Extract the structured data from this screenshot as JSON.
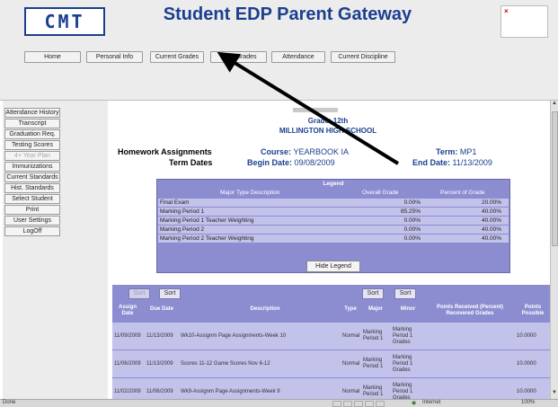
{
  "app": {
    "logo": "CMT",
    "title": "Student EDP Parent Gateway",
    "broken_image": "×"
  },
  "nav": {
    "tabs": [
      {
        "label": "Home"
      },
      {
        "label": "Personal Info"
      },
      {
        "label": "Current Grades"
      },
      {
        "label": "Final Grades"
      },
      {
        "label": "Attendance"
      },
      {
        "label": "Current Discipline"
      }
    ]
  },
  "sidebar": {
    "items": [
      {
        "label": "Attendance History",
        "enabled": true
      },
      {
        "label": "Transcript",
        "enabled": true
      },
      {
        "label": "Graduation Req.",
        "enabled": true
      },
      {
        "label": "Testing Scores",
        "enabled": true
      },
      {
        "label": "4+ Year Plan",
        "enabled": false
      },
      {
        "label": "Immunizations",
        "enabled": true
      },
      {
        "label": "Current Standards",
        "enabled": true
      },
      {
        "label": "Hist. Standards",
        "enabled": true
      },
      {
        "label": "Select Student",
        "enabled": true
      },
      {
        "label": "Print",
        "enabled": true
      },
      {
        "label": "User Settings",
        "enabled": true
      },
      {
        "label": "LogOff",
        "enabled": true
      }
    ]
  },
  "header_info": {
    "grade": "Grade: 12th",
    "school": "MILLINGTON HIGH SCHOOL",
    "section_title": "Homework Assignments",
    "term_dates_label": "Term Dates",
    "course_label": "Course:",
    "course_value": "YEARBOOK IA",
    "term_label": "Term:",
    "term_value": "MP1",
    "begin_label": "Begin Date:",
    "begin_value": "09/08/2009",
    "end_label": "End Date:",
    "end_value": "11/13/2009"
  },
  "legend": {
    "title": "Legend",
    "headers": {
      "description": "Major Type Description",
      "overall": "Overall Grade",
      "percent": "Percent of Grade"
    },
    "rows": [
      {
        "description": "Final Exam",
        "overall": "0.00%",
        "percent": "20.00%"
      },
      {
        "description": "Marking Period 1",
        "overall": "85.25%",
        "percent": "40.00%"
      },
      {
        "description": "Marking Period 1 Teacher Weighting",
        "overall": "0.00%",
        "percent": "40.00%"
      },
      {
        "description": "Marking Period 2",
        "overall": "0.00%",
        "percent": "40.00%"
      },
      {
        "description": "Marking Period 2 Teacher Weighting",
        "overall": "0.00%",
        "percent": "40.00%"
      }
    ],
    "hide_button": "Hide Legend"
  },
  "assignments": {
    "sort_label": "Sort",
    "headers": {
      "assign_date": "Assign Date",
      "due_date": "Due Date",
      "description": "Description",
      "type": "Type",
      "major": "Major",
      "minor": "Minor",
      "points_received": "Points Received (Percent) Recovered Grades",
      "points_possible": "Points Possible"
    },
    "rows": [
      {
        "assign_date": "11/09/2009",
        "due_date": "11/13/2009",
        "description": "Wk10-Assignm   Page Assignments-Week 10",
        "type": "Normal",
        "major": "Marking Period 1",
        "minor": "Marking Period 1 Grades",
        "points_received": "",
        "points_possible": "10.0000"
      },
      {
        "assign_date": "11/06/2009",
        "due_date": "11/13/2009",
        "description": "Scores 11-12   Game Scores Nov 6-12",
        "type": "Normal",
        "major": "Marking Period 1",
        "minor": "Marking Period 1 Grades",
        "points_received": "",
        "points_possible": "10.0000"
      },
      {
        "assign_date": "11/02/2009",
        "due_date": "11/06/2009",
        "description": "Wk9-Assignm   Page Assignments-Week 9",
        "type": "Normal",
        "major": "Marking Period 1",
        "minor": "Marking Period 1 Grades",
        "points_received": "",
        "points_possible": "10.0000"
      }
    ]
  },
  "statusbar": {
    "status": "Done",
    "zone": "Internet",
    "zoom": "100%"
  },
  "colors": {
    "brand_blue": "#1b3f8f",
    "table_header": "#8c8cd1",
    "table_row": "#c2c2ea",
    "annotation_arrow": "#000000"
  }
}
